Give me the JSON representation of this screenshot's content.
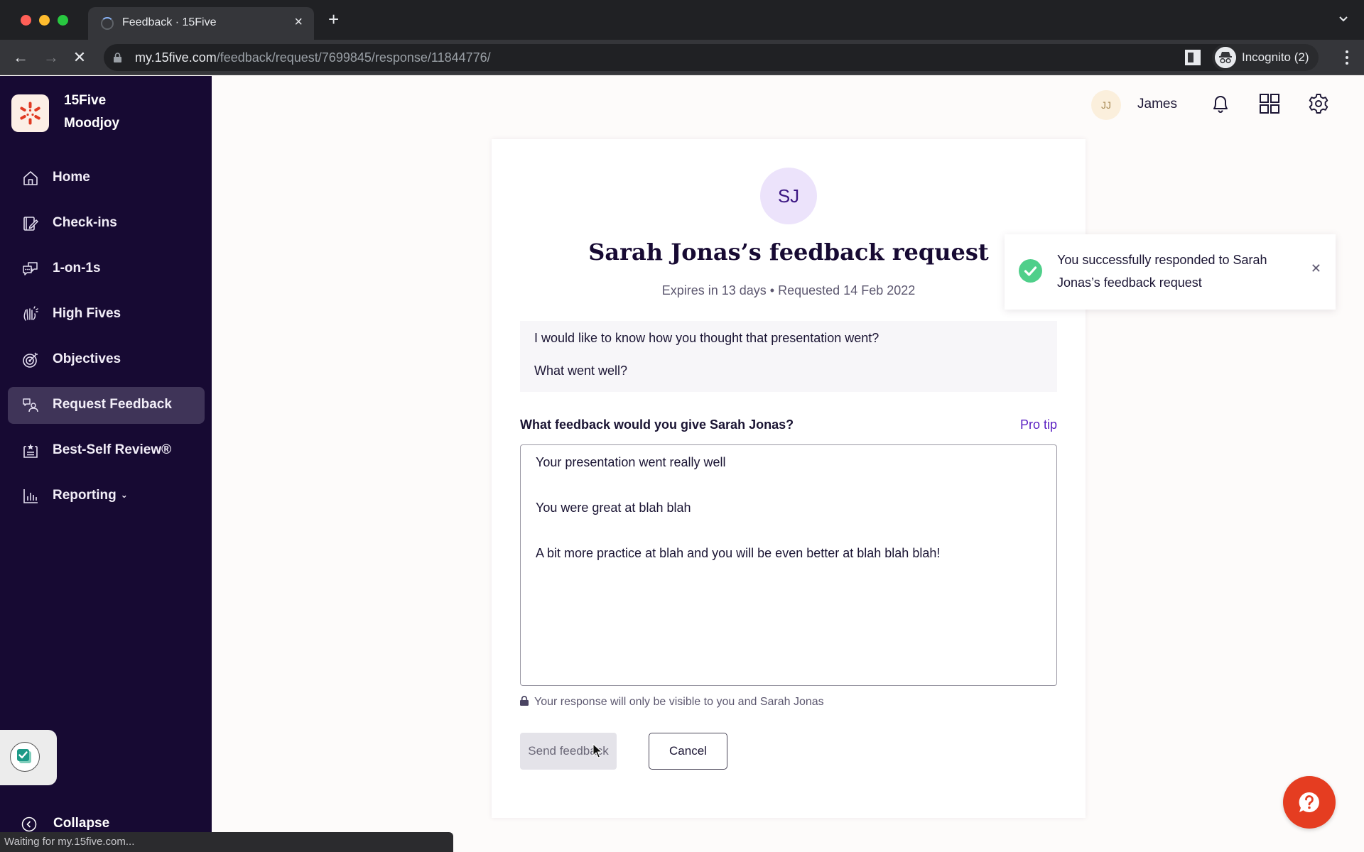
{
  "browser": {
    "tab_title": "Feedback · 15Five",
    "url_host": "my.15five.com",
    "url_path": "/feedback/request/7699845/response/11844776/",
    "incognito_label": "Incognito (2)",
    "status_text": "Waiting for my.15five.com..."
  },
  "sidebar": {
    "org_name": "15Five",
    "org_sub": "Moodjoy",
    "items": [
      {
        "label": "Home",
        "icon": "home-icon"
      },
      {
        "label": "Check-ins",
        "icon": "checkin-icon"
      },
      {
        "label": "1-on-1s",
        "icon": "chat-bubbles-icon"
      },
      {
        "label": "High Fives",
        "icon": "high-five-icon"
      },
      {
        "label": "Objectives",
        "icon": "target-icon"
      },
      {
        "label": "Request Feedback",
        "icon": "feedback-request-icon",
        "active": true
      },
      {
        "label": "Best-Self Review®",
        "icon": "review-icon"
      },
      {
        "label": "Reporting",
        "icon": "bar-chart-icon",
        "has_dropdown": true
      }
    ],
    "collapse_label": "Collapse"
  },
  "header": {
    "user_initials": "JJ",
    "user_name": "James"
  },
  "card": {
    "requester_initials": "SJ",
    "title": "Sarah Jonas’s feedback request",
    "meta": "Expires in 13 days • Requested 14 Feb 2022",
    "question_lines": [
      "I would like to know how you thought that presentation went?",
      "What went well?"
    ],
    "prompt_label": "What feedback would you give Sarah Jonas?",
    "pro_tip_label": "Pro tip",
    "response_lines": [
      "Your presentation went really well",
      "You were great at blah blah",
      "A bit more practice at blah and you will be even better at blah blah blah!"
    ],
    "privacy_note": "Your response will only be visible to you and Sarah Jonas",
    "send_label": "Send feedback",
    "cancel_label": "Cancel"
  },
  "toast": {
    "message": "You successfully responded to Sarah Jonas’s feedback request"
  },
  "colors": {
    "sidebar_bg": "#170a33",
    "sidebar_active": "#3f3458",
    "accent_purple": "#5b20c2",
    "success_green": "#4fcf8a",
    "help_red": "#e53d21"
  }
}
